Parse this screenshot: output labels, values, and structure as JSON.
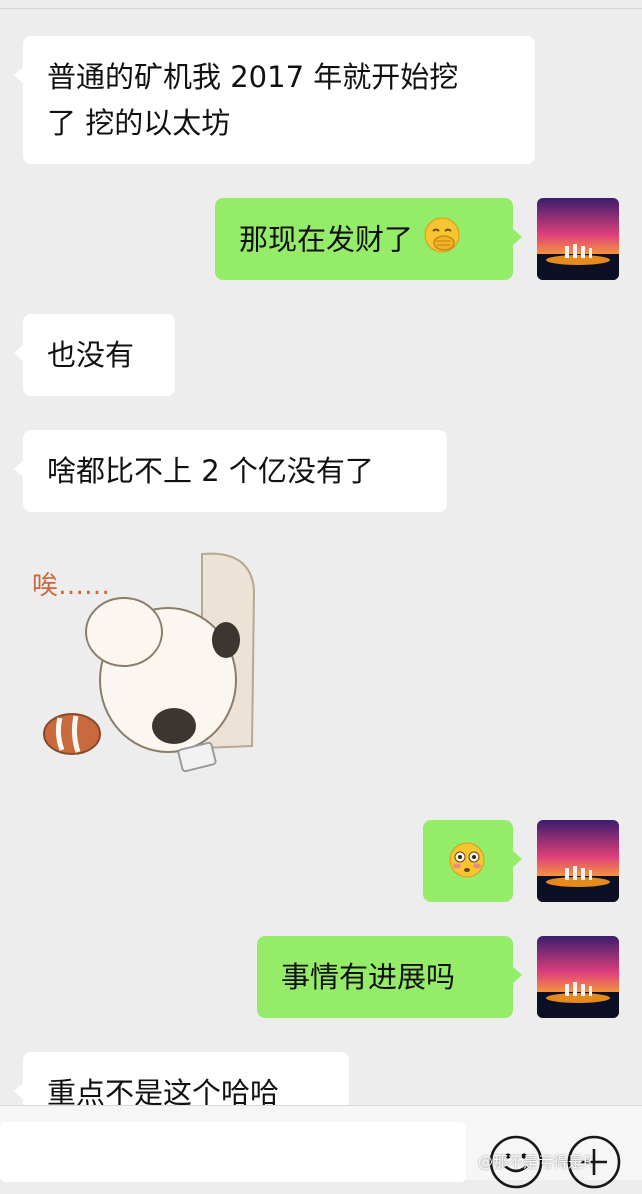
{
  "messages": [
    {
      "side": "left",
      "text_line1": "普通的矿机我 2017 年就开始挖",
      "text_line2": "了 挖的以太坊"
    },
    {
      "side": "right",
      "text": "那现在发财了",
      "emoji": "hand-over-mouth-emoji"
    },
    {
      "side": "left",
      "text": "也没有"
    },
    {
      "side": "left",
      "text": "啥都比不上 2 个亿没有了"
    },
    {
      "side": "left",
      "sticker": "sighing-panda-sticker",
      "sticker_text": "唉……"
    },
    {
      "side": "right",
      "emoji": "flushed-face-emoji"
    },
    {
      "side": "right",
      "text": "事情有进展吗"
    },
    {
      "side": "left",
      "text": "重点不是这个哈哈"
    }
  ],
  "input_bar": {
    "emoji_button_icon": "smiley-icon",
    "more_button_icon": "plus-circle-icon",
    "input_value": ""
  },
  "watermark": "@那不是亏得是R",
  "colors": {
    "background": "#ededed",
    "incoming_bubble": "#ffffff",
    "outgoing_bubble": "#95ec69"
  }
}
